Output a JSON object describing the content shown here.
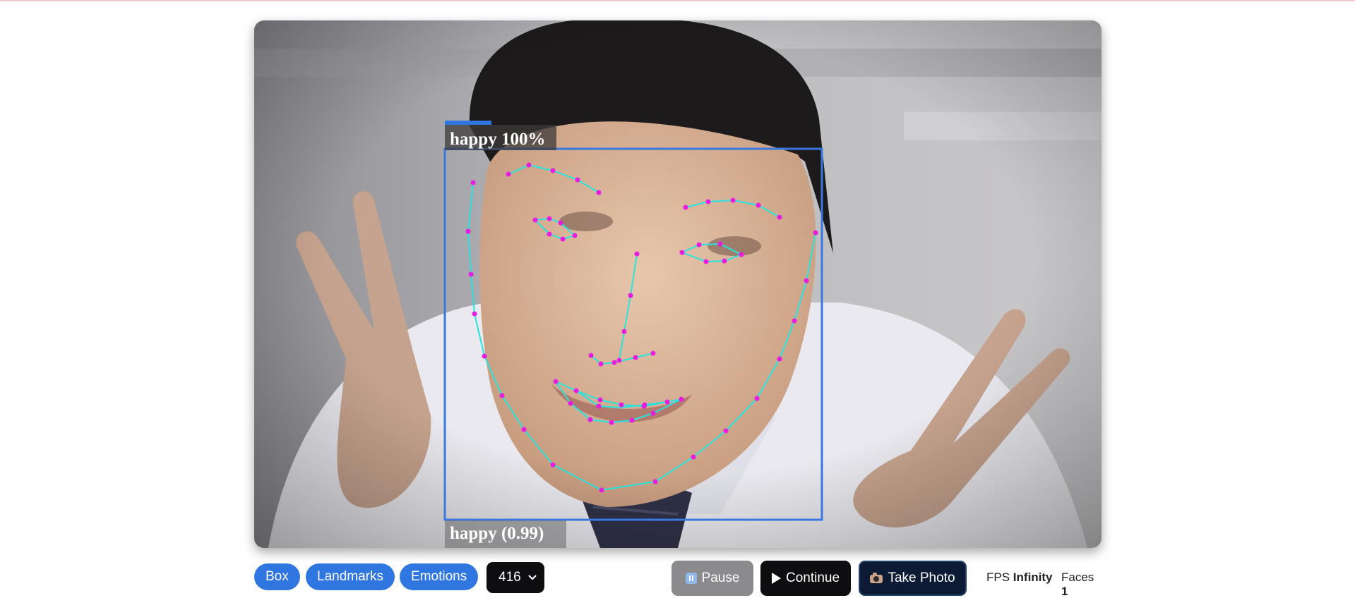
{
  "overlay": {
    "top_label": "happy 100%",
    "bottom_label": "happy (0.99)"
  },
  "toolbar": {
    "box_label": "Box",
    "landmarks_label": "Landmarks",
    "emotions_label": "Emotions",
    "size_select_value": "416",
    "pause_label": "Pause",
    "continue_label": "Continue",
    "take_photo_label": "Take Photo"
  },
  "stats": {
    "fps_label": "FPS",
    "fps_value": "Infinity",
    "faces_label": "Faces",
    "faces_value": "1"
  },
  "colors": {
    "accent_blue": "#2f76e0",
    "box_stroke": "#3a78e0",
    "landmark_line": "#29e3dd",
    "landmark_point": "#e81ce0"
  },
  "icons": {
    "pause": "pause-icon",
    "play": "play-icon",
    "camera": "camera-icon",
    "chevron": "chevron-down-icon"
  }
}
